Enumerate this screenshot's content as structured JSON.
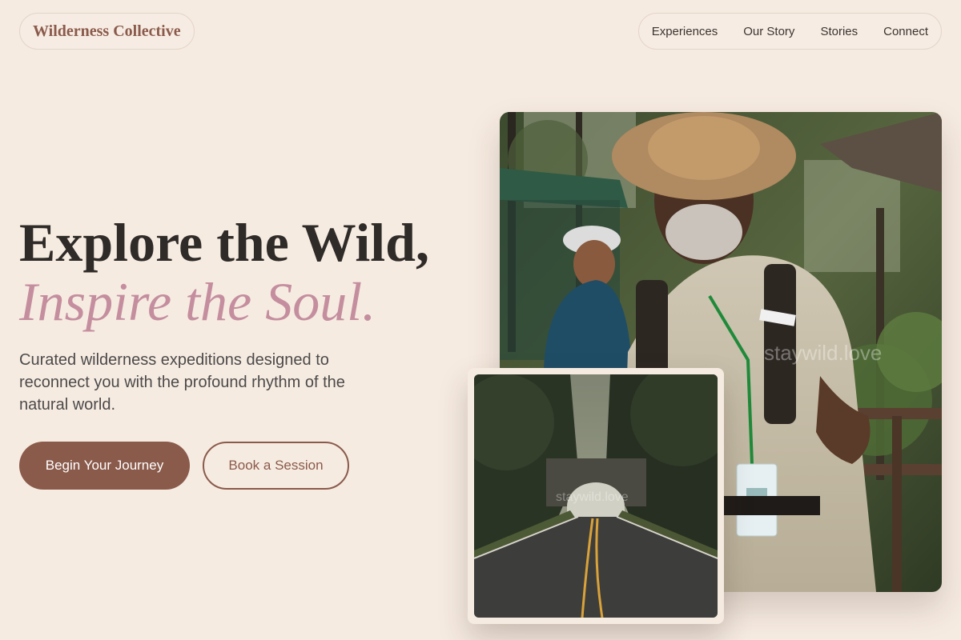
{
  "brand": {
    "name": "Wilderness Collective"
  },
  "nav": {
    "items": [
      {
        "label": "Experiences"
      },
      {
        "label": "Our Story"
      },
      {
        "label": "Stories"
      },
      {
        "label": "Connect"
      }
    ]
  },
  "hero": {
    "headline_line1": "Explore the Wild,",
    "headline_line2": "Inspire the Soul.",
    "description": "Curated wilderness expeditions designed to reconnect you with the profound rhythm of the natural world.",
    "primary_cta": "Begin Your Journey",
    "secondary_cta": "Book a Session"
  },
  "images": {
    "main_watermark": "staywild.love",
    "inset_watermark": "staywild.love"
  },
  "colors": {
    "background": "#f6ebe1",
    "brand": "#8a5a4b",
    "accent_pink": "#c48e9f",
    "text_dark": "#2f2b28"
  }
}
